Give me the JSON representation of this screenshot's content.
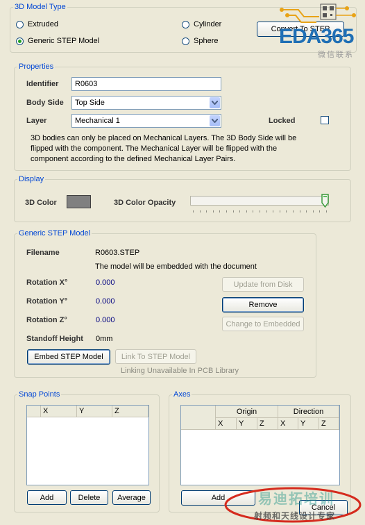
{
  "model_type": {
    "title": "3D Model Type",
    "options": [
      "Extruded",
      "Cylinder",
      "Generic STEP Model",
      "Sphere"
    ],
    "selected": "Generic STEP Model",
    "convert_button": "Convert To STEP"
  },
  "properties": {
    "title": "Properties",
    "identifier_label": "Identifier",
    "identifier_value": "R0603",
    "body_side_label": "Body Side",
    "body_side_value": "Top Side",
    "layer_label": "Layer",
    "layer_value": "Mechanical 1",
    "locked_label": "Locked",
    "locked": false,
    "note": "3D bodies can only be placed on Mechanical Layers. The 3D Body Side will be flipped with the component. The Mechanical Layer will be flipped with the component according to the defined Mechanical Layer Pairs."
  },
  "display": {
    "title": "Display",
    "color_label": "3D Color",
    "color_value": "#808080",
    "opacity_label": "3D Color Opacity",
    "opacity_level": 1.0
  },
  "step_model": {
    "title": "Generic STEP Model",
    "filename_label": "Filename",
    "filename_value": "R0603.STEP",
    "embed_note": "The model will be embedded with the document",
    "rotation_x_label": "Rotation X°",
    "rotation_x_value": "0.000",
    "rotation_y_label": "Rotation Y°",
    "rotation_y_value": "0.000",
    "rotation_z_label": "Rotation Z°",
    "rotation_z_value": "0.000",
    "standoff_label": "Standoff Height",
    "standoff_value": "0mm",
    "update_button": "Update from Disk",
    "remove_button": "Remove",
    "change_button": "Change to Embedded",
    "embed_button": "Embed STEP Model",
    "link_button": "Link To STEP Model",
    "link_note": "Linking Unavailable In PCB Library"
  },
  "snap_points": {
    "title": "Snap Points",
    "columns": [
      "X",
      "Y",
      "Z"
    ],
    "add_button": "Add",
    "delete_button": "Delete",
    "average_button": "Average"
  },
  "axes": {
    "title": "Axes",
    "group_origin": "Origin",
    "group_direction": "Direction",
    "columns": [
      "X",
      "Y",
      "Z",
      "X",
      "Y",
      "Z"
    ],
    "add_button": "Add"
  },
  "footer": {
    "cancel_button": "Cancel"
  },
  "watermark": {
    "logo_text": "EDA365",
    "logo_sub": "微信联系",
    "banner_text": "易迪拓培训",
    "banner_sub": "射频和天线设计专家"
  }
}
